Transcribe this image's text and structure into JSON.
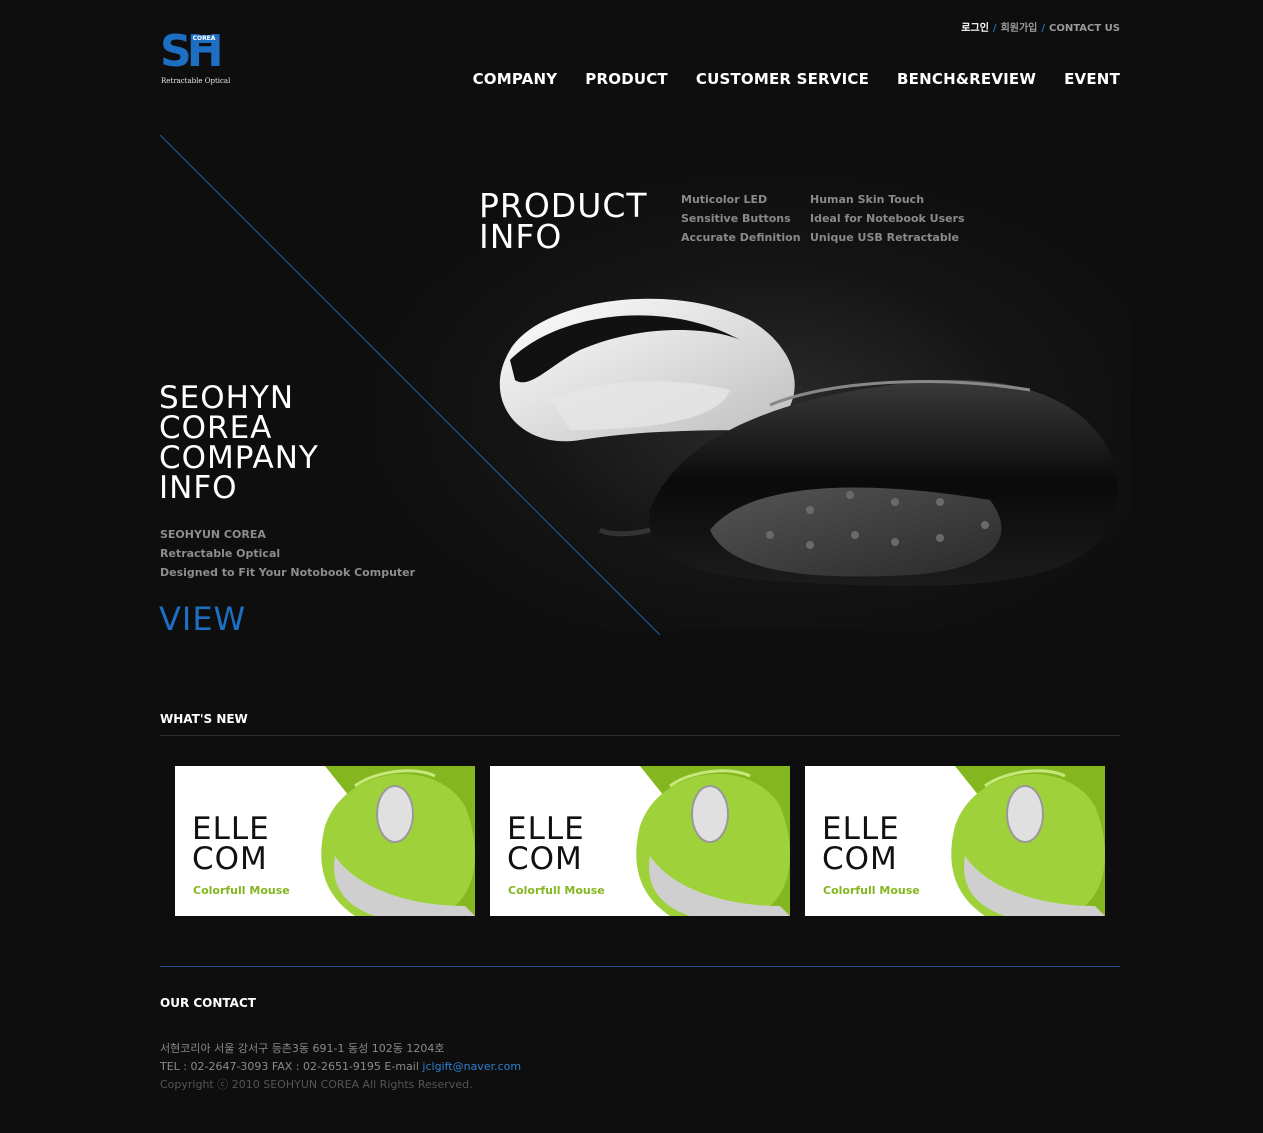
{
  "brand": {
    "logo_text": "SH",
    "logo_badge": "COREA",
    "tagline": "Retractable Optical",
    "accent": "#1d6fc4"
  },
  "utility": {
    "login": "로그인",
    "separator": "/",
    "signup": "회원가입",
    "contact": "CONTACT US"
  },
  "nav": {
    "items": [
      "COMPANY",
      "PRODUCT",
      "CUSTOMER SERVICE",
      "BENCH&REVIEW",
      "EVENT"
    ]
  },
  "hero": {
    "product_title": [
      "PRODUCT",
      "INFO"
    ],
    "features_col1": [
      "Muticolor LED",
      "Sensitive Buttons",
      "Accurate Definition"
    ],
    "features_col2": [
      "Human Skin Touch",
      "Ideal for Notebook Users",
      "Unique USB Retractable"
    ],
    "company_title": [
      "SEOHYN",
      "COREA",
      "COMPANY",
      "INFO"
    ],
    "company_sub": [
      "SEOHYUN COREA",
      "Retractable Optical",
      "Designed to Fit Your Notobook Computer"
    ],
    "view_label": "VIEW"
  },
  "whats_new": {
    "title": "WHAT'S NEW",
    "cards": [
      {
        "title": [
          "ELLE",
          "COM"
        ],
        "subtitle": "Colorfull Mouse"
      },
      {
        "title": [
          "ELLE",
          "COM"
        ],
        "subtitle": "Colorfull Mouse"
      },
      {
        "title": [
          "ELLE",
          "COM"
        ],
        "subtitle": "Colorfull Mouse"
      }
    ],
    "accent": "#84b61f"
  },
  "footer": {
    "title": "OUR CONTACT",
    "address": "서현코리아 서울 강서구 등촌3동 691-1 동성 102동 1204호",
    "tel_prefix": "TEL : 02-2647-3093 FAX : 02-2651-9195 E-mail ",
    "email": "jclgift@naver.com",
    "copyright": "Copyright ⓒ 2010 SEOHYUN COREA All Rights Reserved."
  }
}
